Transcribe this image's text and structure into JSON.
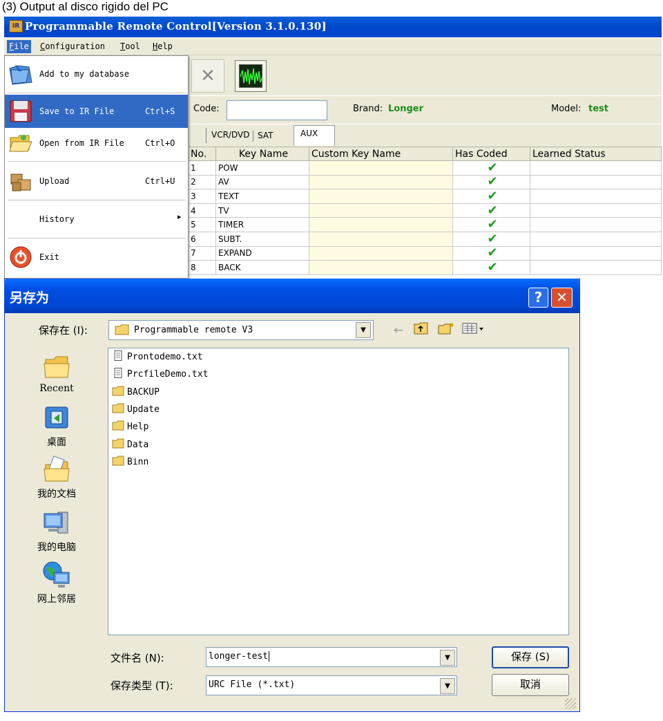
{
  "caption": "(3) Output al disco rigido del PC",
  "app": {
    "icon_text": "IR",
    "title": "Programmable Remote Control[Version 3.1.0.130]"
  },
  "menubar": {
    "file_prefix": "F",
    "file_rest": "ile",
    "config_prefix": "C",
    "config_rest": "onfiguration",
    "tool_prefix": "T",
    "tool_rest": "ool",
    "help_prefix": "H",
    "help_rest": "elp"
  },
  "file_menu": {
    "add": {
      "label": "Add to my database",
      "shortcut": ""
    },
    "save": {
      "label": "Save to  IR File",
      "shortcut": "Ctrl+S"
    },
    "open": {
      "label": "Open from IR File",
      "shortcut": "Ctrl+O"
    },
    "upload": {
      "label": "Upload",
      "shortcut": "Ctrl+U"
    },
    "history": {
      "label": "History",
      "arrow": "▸"
    },
    "exit": {
      "label": "Exit"
    }
  },
  "toolbar": {
    "delete_glyph": "✕"
  },
  "info": {
    "code_label": "Code:",
    "code_value": "",
    "brand_label": "Brand:",
    "brand_value": "Longer",
    "model_label": "Model:",
    "model_value": "test",
    "value_color": "#1a8f1a"
  },
  "tabs": {
    "vcr": "VCR/DVD",
    "sat": "SAT",
    "aux": "AUX"
  },
  "grid": {
    "headers": {
      "no": "No.",
      "key": "Key Name",
      "custom": "Custom Key Name",
      "coded": "Has Coded",
      "learned": "Learned Status"
    },
    "rows": [
      {
        "no": "1",
        "key": "POW",
        "custom": "",
        "coded": "✔",
        "learned": ""
      },
      {
        "no": "2",
        "key": "AV",
        "custom": "",
        "coded": "✔",
        "learned": ""
      },
      {
        "no": "3",
        "key": "TEXT",
        "custom": "",
        "coded": "✔",
        "learned": ""
      },
      {
        "no": "4",
        "key": "TV",
        "custom": "",
        "coded": "✔",
        "learned": ""
      },
      {
        "no": "5",
        "key": "TIMER",
        "custom": "",
        "coded": "✔",
        "learned": ""
      },
      {
        "no": "6",
        "key": "SUBT.",
        "custom": "",
        "coded": "✔",
        "learned": ""
      },
      {
        "no": "7",
        "key": "EXPAND",
        "custom": "",
        "coded": "✔",
        "learned": ""
      },
      {
        "no": "8",
        "key": "BACK",
        "custom": "",
        "coded": "✔",
        "learned": ""
      }
    ]
  },
  "dialog": {
    "title": "另存为",
    "help_glyph": "?",
    "close_glyph": "✕",
    "save_in_label": "保存在 (I):",
    "save_in_value": "Programmable remote V3",
    "dropdown_glyph": "▼",
    "places": {
      "recent": "Recent",
      "desktop": "桌面",
      "documents": "我的文档",
      "computer": "我的电脑",
      "network": "网上邻居"
    },
    "files": [
      {
        "name": "Prontodemo.txt",
        "type": "file"
      },
      {
        "name": "PrcfileDemo.txt",
        "type": "file"
      },
      {
        "name": "BACKUP",
        "type": "folder"
      },
      {
        "name": "Update",
        "type": "folder"
      },
      {
        "name": "Help",
        "type": "folder"
      },
      {
        "name": "Data",
        "type": "folder"
      },
      {
        "name": "Binn",
        "type": "folder"
      }
    ],
    "filename_label": "文件名 (N):",
    "filename_value": "longer-test",
    "filetype_label": "保存类型 (T):",
    "filetype_value": "URC File (*.txt)",
    "save_button": "保存 (S)",
    "cancel_button": "取消"
  }
}
